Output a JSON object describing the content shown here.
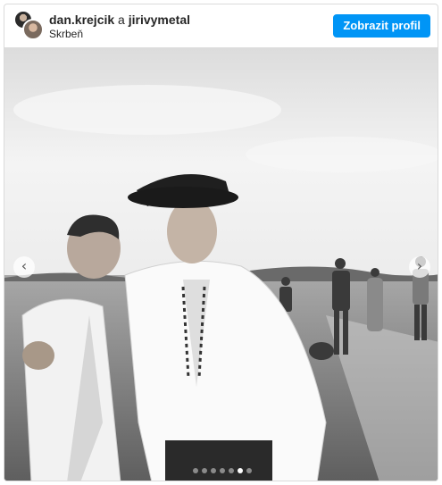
{
  "post": {
    "user1": "dan.krejcik",
    "conjunction": "a",
    "user2": "jirivymetal",
    "location": "Skrbeň",
    "profile_button": "Zobrazit profil"
  },
  "carousel": {
    "prev_icon": "chevron-left-icon",
    "next_icon": "chevron-right-icon",
    "slide_count": 7,
    "active_index": 5
  },
  "colors": {
    "button": "#0095f6",
    "border": "#dbdbdb"
  }
}
